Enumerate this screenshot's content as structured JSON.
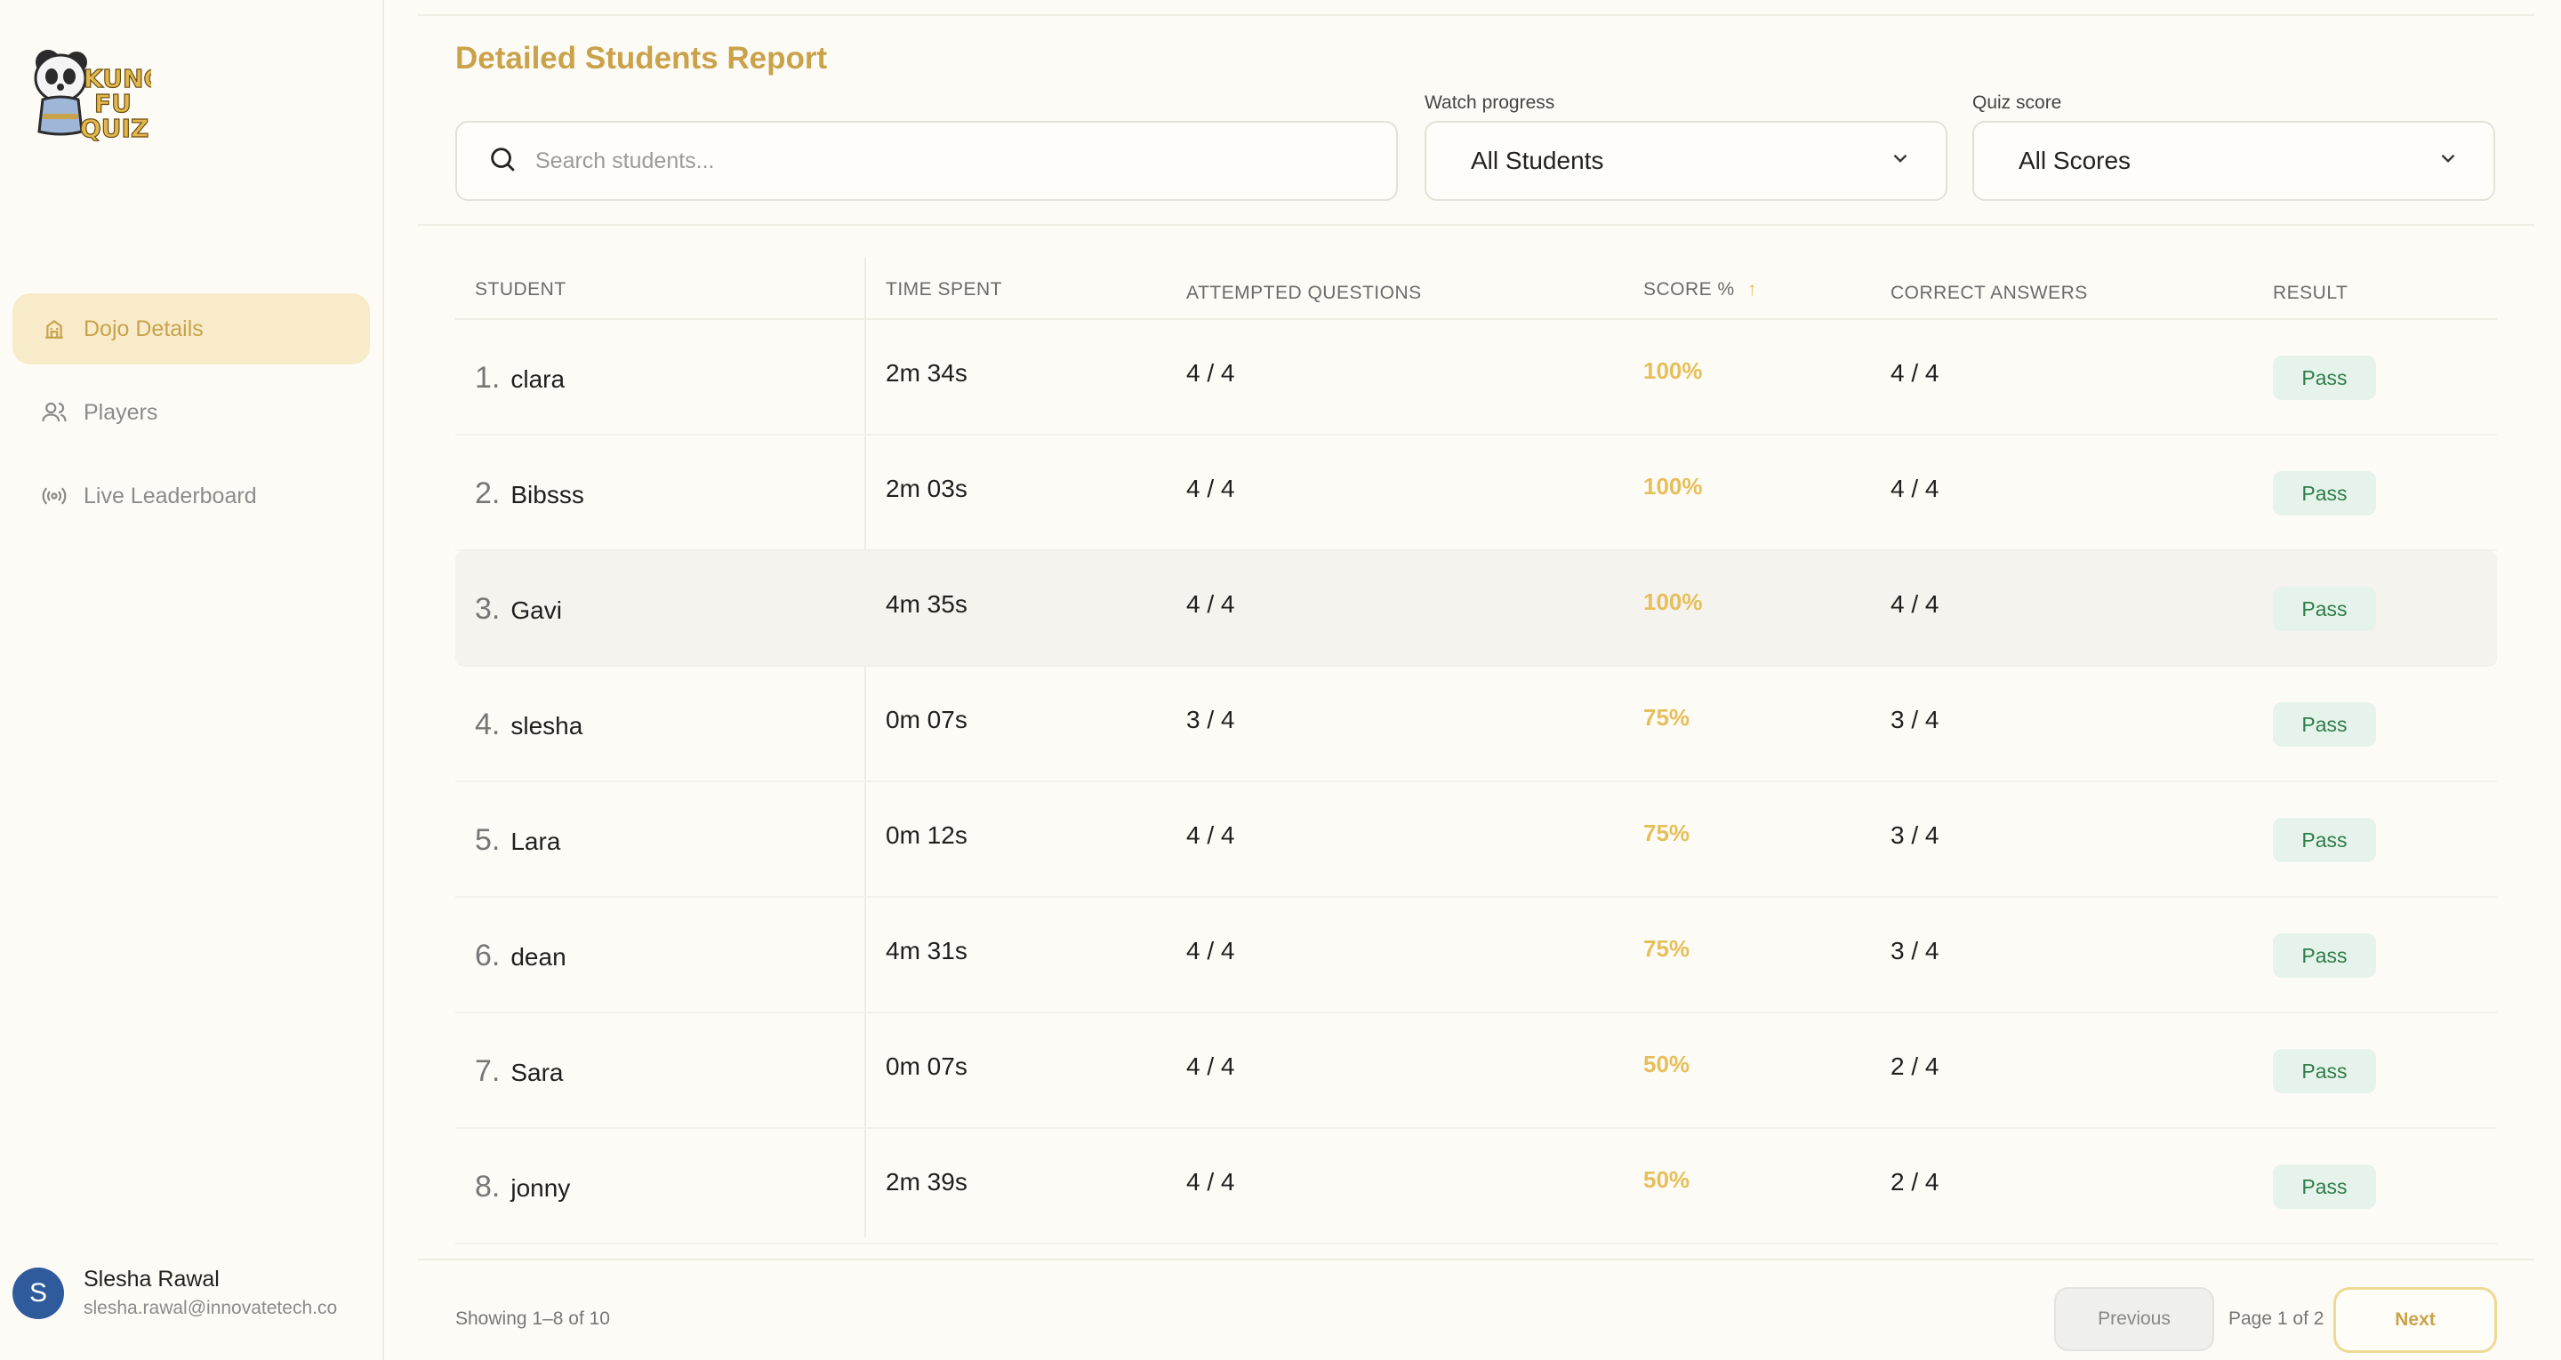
{
  "app": {
    "logo_text": "KUNG FU QUIZ"
  },
  "sidebar": {
    "items": [
      {
        "label": "Dojo Details",
        "icon": "building-icon",
        "active": true
      },
      {
        "label": "Players",
        "icon": "users-icon",
        "active": false
      },
      {
        "label": "Live Leaderboard",
        "icon": "broadcast-icon",
        "active": false
      }
    ],
    "user": {
      "initial": "S",
      "name": "Slesha Rawal",
      "email": "slesha.rawal@innovatetech.co"
    }
  },
  "report": {
    "title": "Detailed Students Report",
    "search": {
      "placeholder": "Search students..."
    },
    "filters": {
      "watch_label": "Watch progress",
      "watch_value": "All Students",
      "quiz_label": "Quiz score",
      "quiz_value": "All Scores"
    },
    "columns": [
      "STUDENT",
      "TIME SPENT",
      "ATTEMPTED QUESTIONS",
      "SCORE %",
      "CORRECT ANSWERS",
      "RESULT"
    ],
    "sort_indicator": "↑",
    "rows": [
      {
        "rank": "1.",
        "name": "clara",
        "time": "2m 34s",
        "attempted": "4 / 4",
        "score": "100%",
        "correct": "4 / 4",
        "result": "Pass"
      },
      {
        "rank": "2.",
        "name": "Bibsss",
        "time": "2m 03s",
        "attempted": "4 / 4",
        "score": "100%",
        "correct": "4 / 4",
        "result": "Pass"
      },
      {
        "rank": "3.",
        "name": "Gavi",
        "time": "4m 35s",
        "attempted": "4 / 4",
        "score": "100%",
        "correct": "4 / 4",
        "result": "Pass"
      },
      {
        "rank": "4.",
        "name": "slesha",
        "time": "0m 07s",
        "attempted": "3 / 4",
        "score": "75%",
        "correct": "3 / 4",
        "result": "Pass"
      },
      {
        "rank": "5.",
        "name": "Lara",
        "time": "0m 12s",
        "attempted": "4 / 4",
        "score": "75%",
        "correct": "3 / 4",
        "result": "Pass"
      },
      {
        "rank": "6.",
        "name": "dean",
        "time": "4m 31s",
        "attempted": "4 / 4",
        "score": "75%",
        "correct": "3 / 4",
        "result": "Pass"
      },
      {
        "rank": "7.",
        "name": "Sara",
        "time": "0m 07s",
        "attempted": "4 / 4",
        "score": "50%",
        "correct": "2 / 4",
        "result": "Pass"
      },
      {
        "rank": "8.",
        "name": "jonny",
        "time": "2m 39s",
        "attempted": "4 / 4",
        "score": "50%",
        "correct": "2 / 4",
        "result": "Pass"
      }
    ],
    "footer": {
      "showing": "Showing 1–8 of 10",
      "previous": "Previous",
      "page_info": "Page 1 of 2",
      "next": "Next"
    }
  },
  "colors": {
    "accent": "#c9a24a",
    "score": "#e6bf5c",
    "pass_bg": "#e6f3ea",
    "pass_text": "#2f7d4a"
  }
}
